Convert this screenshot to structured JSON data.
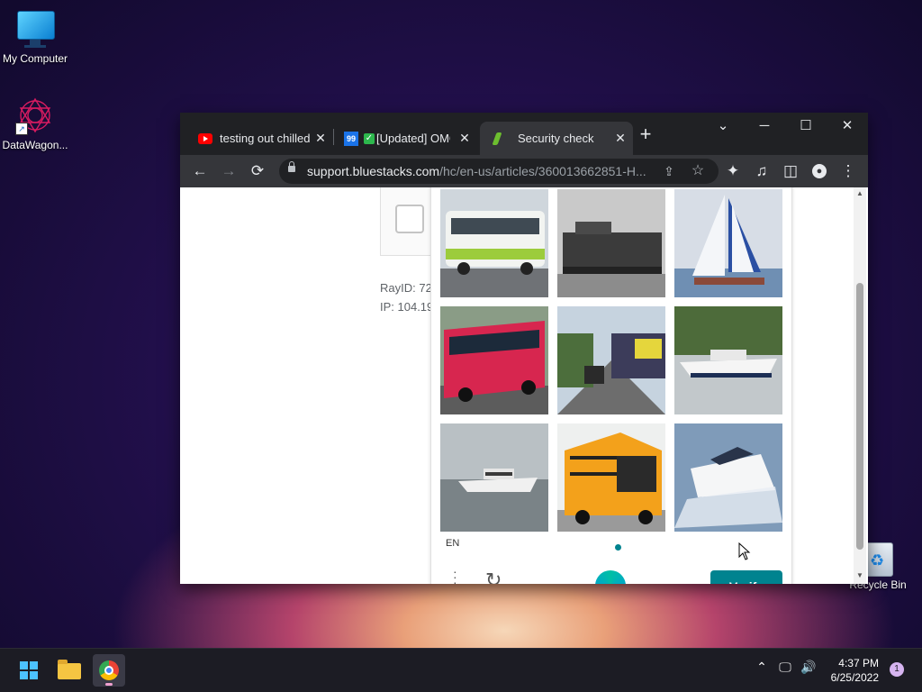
{
  "desktop": {
    "icons": [
      {
        "label": "My Computer",
        "icon": "monitor-icon"
      },
      {
        "label": "DataWagon...",
        "icon": "datawagon-logo-icon"
      },
      {
        "label": "Recycle Bin",
        "icon": "recycle-bin-icon"
      }
    ]
  },
  "browser": {
    "tabs": [
      {
        "title": "testing out chilled",
        "favicon": "youtube-icon",
        "close": "✕"
      },
      {
        "title": "[Updated] OMG",
        "favicon": "99-icon",
        "close": "✕"
      },
      {
        "title": "Security check",
        "favicon": "bluestacks-leaf-icon",
        "close": "✕",
        "active": true
      }
    ],
    "new_tab": "+",
    "window_controls": {
      "tab_search": "⌄",
      "minimize": "─",
      "maximize": "☐",
      "close": "✕"
    },
    "toolbar": {
      "back": "←",
      "forward": "→",
      "reload": "⟳",
      "extensions": "✦",
      "media": "♫",
      "sidepanel": "◫",
      "menu": "⋮"
    },
    "address_bar": {
      "host": "support.bluestacks.com",
      "path": "/hc/en-us/articles/360013662851-H..."
    }
  },
  "page": {
    "ray_id": "RayID: 72",
    "ip": "IP: 104.19"
  },
  "captcha": {
    "images": [
      {
        "subject": "bus"
      },
      {
        "subject": "train"
      },
      {
        "subject": "sailboat"
      },
      {
        "subject": "bus"
      },
      {
        "subject": "train"
      },
      {
        "subject": "motorboat"
      },
      {
        "subject": "yacht"
      },
      {
        "subject": "bus"
      },
      {
        "subject": "motorboat"
      }
    ],
    "language": "EN",
    "verify_label": "Verify",
    "accent": "#00838f"
  },
  "taskbar": {
    "apps": [
      "start-icon",
      "file-explorer-icon",
      "chrome-icon"
    ],
    "time": "4:37 PM",
    "date": "6/25/2022",
    "notifications": "1"
  }
}
